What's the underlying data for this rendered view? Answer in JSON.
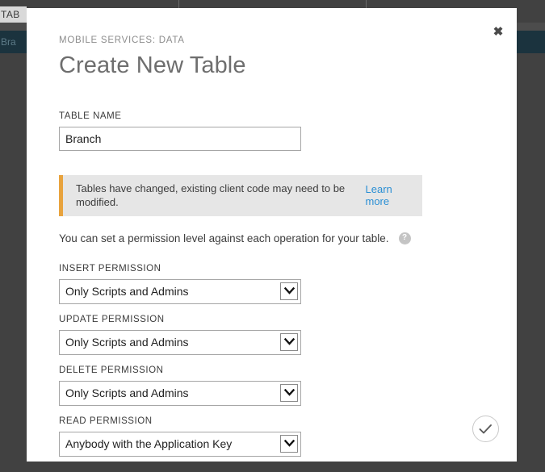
{
  "background": {
    "breadcrumb_fragment": "TAB",
    "row_fragment": "Bra"
  },
  "modal": {
    "eyebrow": "MOBILE SERVICES: DATA",
    "title": "Create New Table",
    "close_label": "✖",
    "table_name": {
      "label": "TABLE NAME",
      "value": "Branch",
      "placeholder": ""
    },
    "warning": {
      "text": "Tables have changed, existing client code may need to be modified.",
      "link_label": "Learn more",
      "accent_color": "#e8a33d",
      "background_color": "#e6e6e6",
      "link_color": "#2a8fd4"
    },
    "helper": {
      "text": "You can set a permission level against each operation for your table.",
      "help_icon": "question-mark"
    },
    "permissions": [
      {
        "label": "INSERT PERMISSION",
        "value": "Only Scripts and Admins",
        "name": "insert-permission"
      },
      {
        "label": "UPDATE PERMISSION",
        "value": "Only Scripts and Admins",
        "name": "update-permission"
      },
      {
        "label": "DELETE PERMISSION",
        "value": "Only Scripts and Admins",
        "name": "delete-permission"
      },
      {
        "label": "READ PERMISSION",
        "value": "Anybody with the Application Key",
        "name": "read-permission"
      }
    ],
    "confirm": {
      "icon": "checkmark-icon",
      "label": "Create"
    }
  }
}
